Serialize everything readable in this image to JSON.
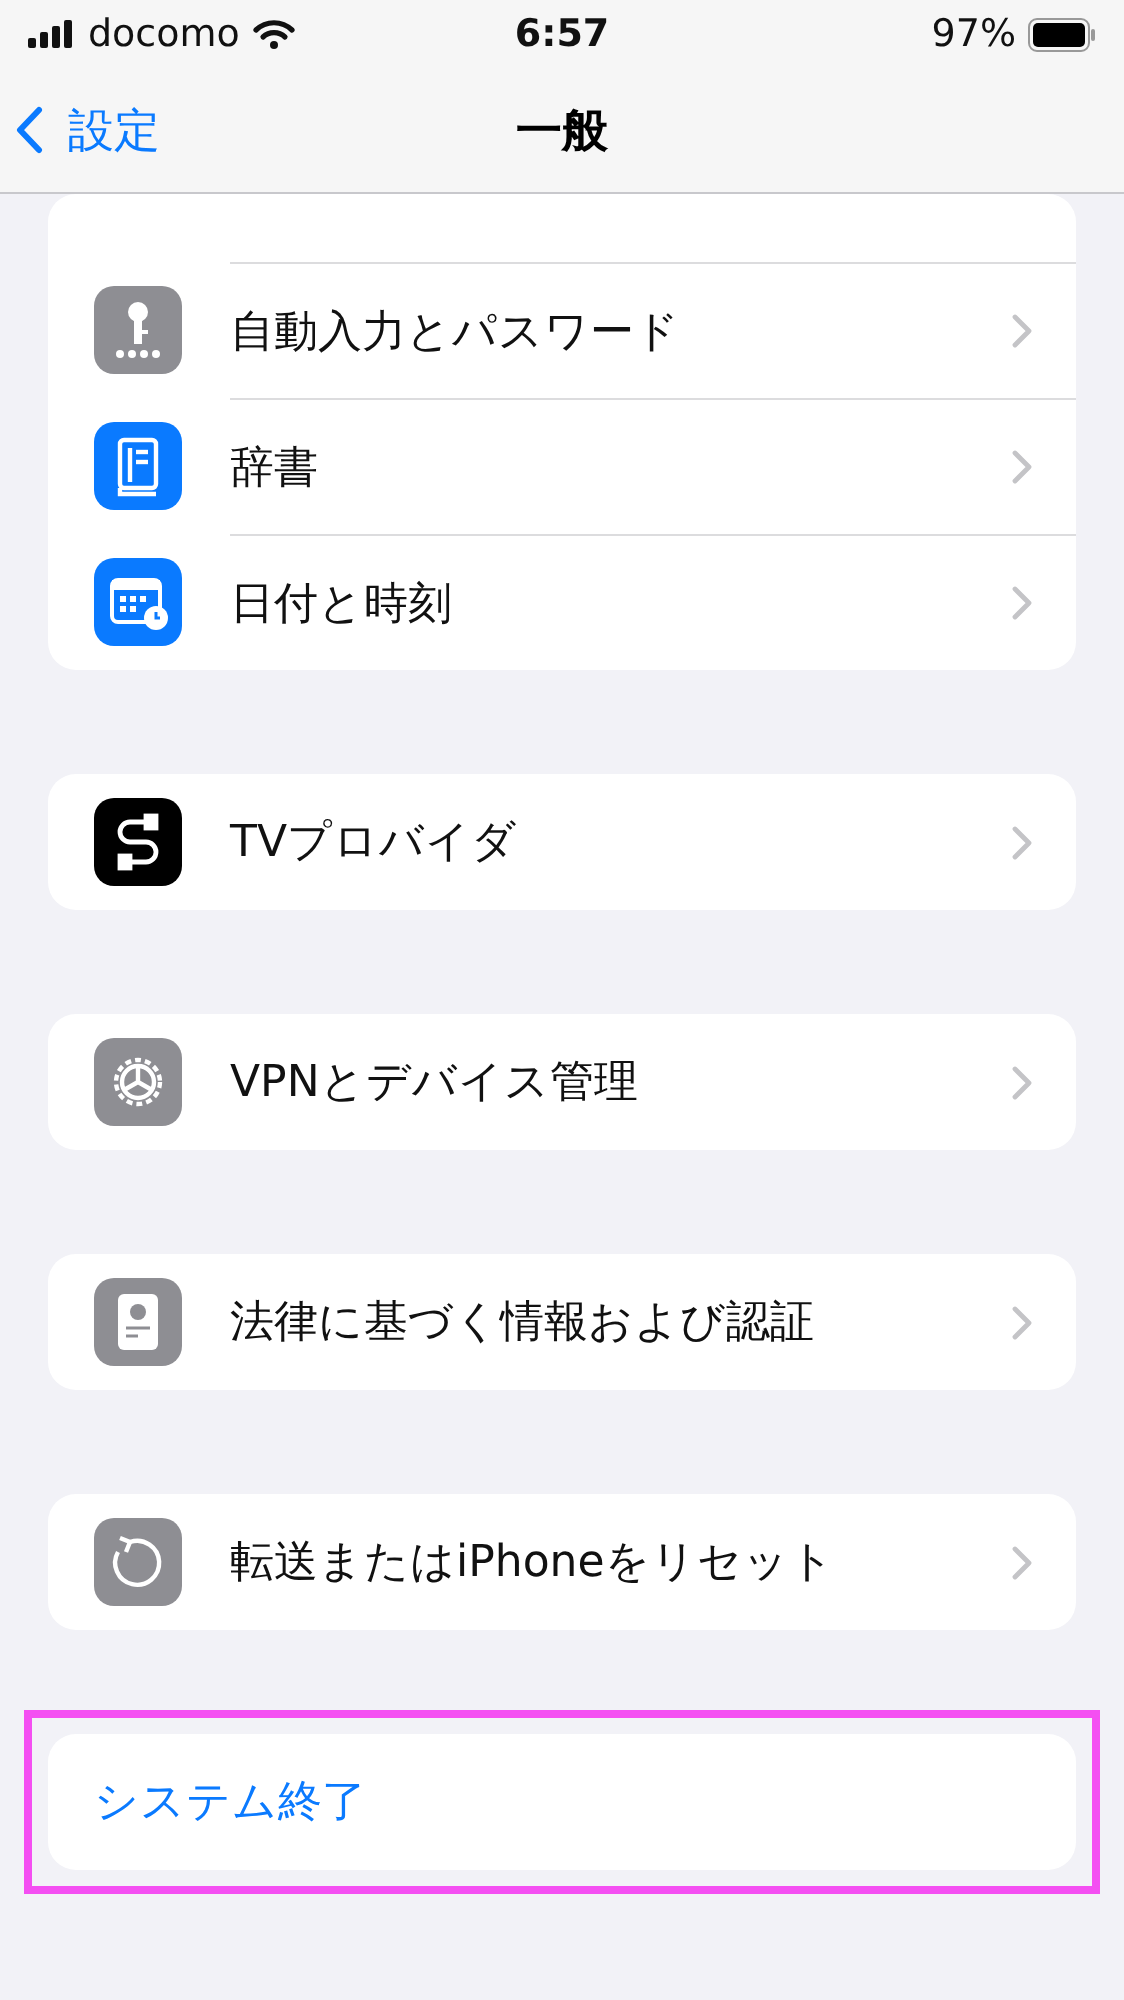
{
  "status_bar": {
    "carrier": "docomo",
    "time": "6:57",
    "battery": "97%"
  },
  "nav_bar": {
    "back": "設定",
    "title": "一般"
  },
  "groups": [
    {
      "highlighted": false,
      "cut_top": true,
      "items": [
        {
          "kind": "key",
          "color": "#8e8e93",
          "label": "自動入力とパスワード"
        },
        {
          "kind": "book",
          "color": "#0a7aff",
          "label": "辞書"
        },
        {
          "kind": "calendar",
          "color": "#0a7aff",
          "label": "日付と時刻"
        }
      ]
    },
    {
      "highlighted": false,
      "items": [
        {
          "kind": "cable",
          "color": "#000000",
          "label": "TVプロバイダ"
        }
      ]
    },
    {
      "highlighted": false,
      "items": [
        {
          "kind": "gear",
          "color": "#8e8e93",
          "label": "VPNとデバイス管理"
        }
      ]
    },
    {
      "highlighted": false,
      "items": [
        {
          "kind": "certificate",
          "color": "#8e8e93",
          "label": "法律に基づく情報および認証"
        }
      ]
    },
    {
      "highlighted": false,
      "items": [
        {
          "kind": "reset",
          "color": "#8e8e93",
          "label": "転送またはiPhoneをリセット"
        }
      ]
    },
    {
      "highlighted": true,
      "items": [
        {
          "kind": "action",
          "label": "システム終了"
        }
      ]
    }
  ]
}
